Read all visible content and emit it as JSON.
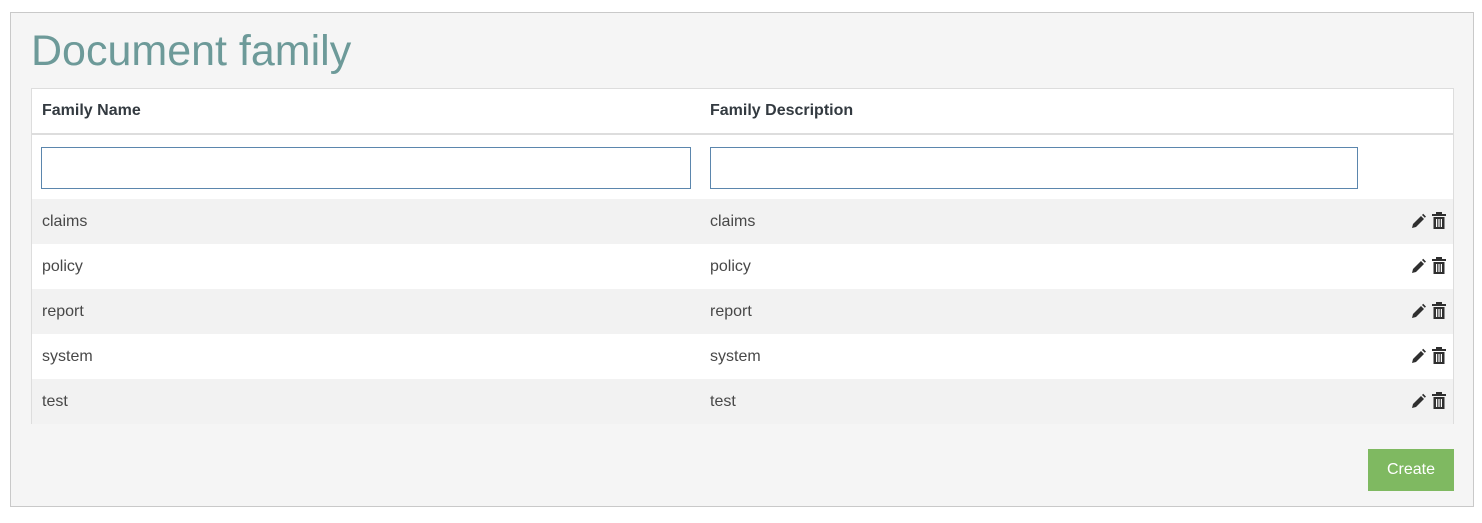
{
  "page": {
    "title": "Document family"
  },
  "grid": {
    "columns": {
      "name": "Family Name",
      "description": "Family Description"
    },
    "filters": {
      "name_value": "",
      "description_value": ""
    },
    "rows": [
      {
        "name": "claims",
        "description": "claims"
      },
      {
        "name": "policy",
        "description": "policy"
      },
      {
        "name": "report",
        "description": "report"
      },
      {
        "name": "system",
        "description": "system"
      },
      {
        "name": "test",
        "description": "test"
      }
    ],
    "row_actions": [
      "pencil-icon",
      "trash-icon"
    ]
  },
  "footer": {
    "create_label": "Create"
  },
  "colors": {
    "title": "#6d9a99",
    "create_button": "#7fb961",
    "filter_border": "#5b86ad",
    "striped_row": "#f2f2f2"
  }
}
